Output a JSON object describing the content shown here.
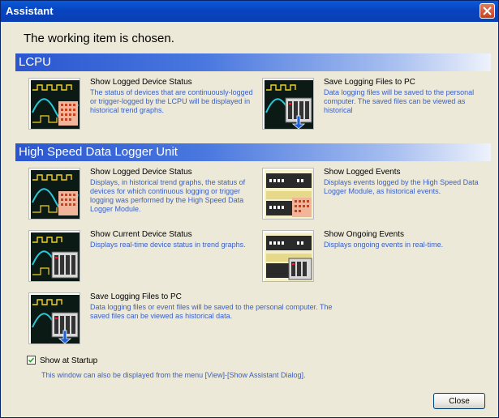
{
  "window": {
    "title": "Assistant",
    "close_icon": "close-icon"
  },
  "heading": "The working item is chosen.",
  "lcpu": {
    "title": "LCPU",
    "items": [
      {
        "title": "Show Logged Device Status",
        "desc": "The status of devices that are continuously-logged or trigger-logged by the LCPU will be displayed in historical trend graphs.",
        "icon": "trend-graph-icon"
      },
      {
        "title": "Save Logging Files to PC",
        "desc": "Data logging files will be saved to the personal computer. The saved files can be viewed as historical",
        "icon": "save-to-pc-icon"
      }
    ]
  },
  "hsdl": {
    "title": "High Speed Data Logger Unit",
    "items": [
      {
        "title": "Show Logged Device Status",
        "desc": "Displays, in historical trend graphs, the status of devices for which continuous logging or trigger logging was performed by the High Speed Data Logger Module.",
        "icon": "trend-graph-icon"
      },
      {
        "title": "Show Logged Events",
        "desc": "Displays events logged by the High Speed Data Logger Module, as historical events.",
        "icon": "event-log-icon"
      },
      {
        "title": "Show Current Device Status",
        "desc": "Displays real-time device status in trend graphs.",
        "icon": "realtime-trend-icon"
      },
      {
        "title": "Show Ongoing Events",
        "desc": "Displays ongoing events in real-time.",
        "icon": "ongoing-events-icon"
      },
      {
        "title": "Save Logging Files to PC",
        "desc": "Data logging files or event files will be saved to the personal computer. The saved files can be viewed as historical data.",
        "icon": "save-to-pc-icon"
      }
    ]
  },
  "startup": {
    "label": "Show at Startup",
    "checked": true,
    "note": "This window can also be displayed from the menu [View]-[Show Assistant Dialog]."
  },
  "buttons": {
    "close": "Close"
  },
  "colors": {
    "title_bar": "#0a46c8",
    "section_bar": "#3a66d8",
    "description_text": "#3a60c8",
    "window_bg": "#ece9d8"
  }
}
